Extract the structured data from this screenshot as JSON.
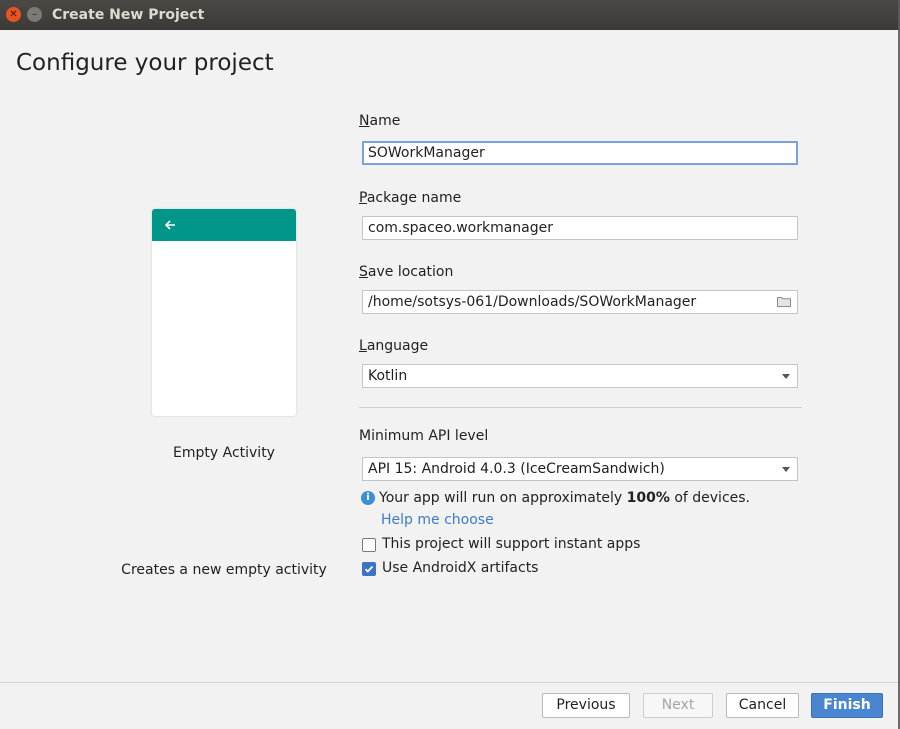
{
  "window": {
    "title": "Create New Project"
  },
  "heading": "Configure your project",
  "template": {
    "name": "Empty Activity",
    "description": "Creates a new empty activity"
  },
  "form": {
    "name": {
      "label_accel": "N",
      "label_rest": "ame",
      "value": "SOWorkManager"
    },
    "package": {
      "label_accel": "P",
      "label_rest": "ackage name",
      "value": "com.spaceo.workmanager"
    },
    "save_location": {
      "label_accel": "S",
      "label_rest": "ave location",
      "value": "/home/sotsys-061/Downloads/SOWorkManager"
    },
    "language": {
      "label_accel": "L",
      "label_rest": "anguage",
      "value": "Kotlin"
    },
    "min_api": {
      "label": "Minimum API level",
      "value": "API 15: Android 4.0.3 (IceCreamSandwich)"
    },
    "info": {
      "prefix": "Your app will run on approximately ",
      "percent": "100%",
      "suffix": " of devices."
    },
    "help_link": "Help me choose",
    "instant_apps": {
      "label": "This project will support instant apps",
      "checked": false
    },
    "androidx": {
      "label": "Use AndroidX artifacts",
      "checked": true
    }
  },
  "buttons": {
    "previous": "Previous",
    "next": "Next",
    "cancel": "Cancel",
    "finish": "Finish"
  },
  "colors": {
    "accent": "#00968a",
    "primary_button": "#4a86cf",
    "link": "#3f7cc4"
  }
}
